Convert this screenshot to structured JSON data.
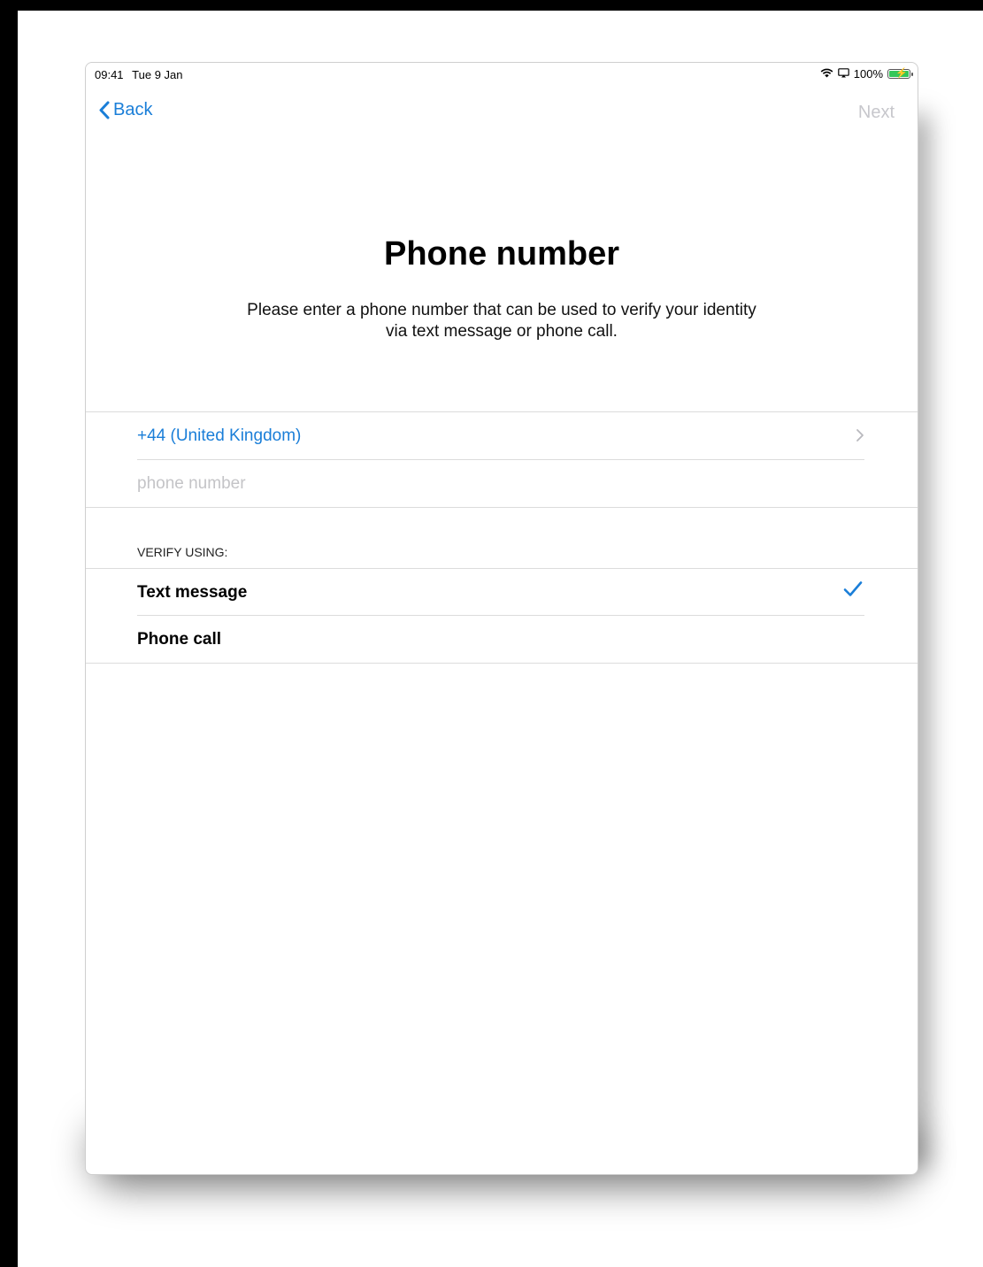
{
  "status_bar": {
    "time": "09:41",
    "date": "Tue 9 Jan",
    "battery": "100%"
  },
  "nav": {
    "back_label": "Back",
    "next_label": "Next"
  },
  "page": {
    "title": "Phone number",
    "subtitle_line1": "Please enter a phone number that can be used to verify your identity",
    "subtitle_line2": "via text message or phone call."
  },
  "phone": {
    "country": "+44 (United Kingdom)",
    "placeholder": "phone number",
    "value": ""
  },
  "verify": {
    "header": "VERIFY USING:",
    "options": [
      {
        "label": "Text message",
        "selected": true
      },
      {
        "label": "Phone call",
        "selected": false
      }
    ]
  },
  "colors": {
    "accent": "#1a7ed8",
    "disabled": "#c7c7cc",
    "battery": "#34c759"
  },
  "icons": [
    "wifi-icon",
    "screen-mirror-icon",
    "battery-icon",
    "chevron-left-icon",
    "chevron-right-icon",
    "checkmark-icon"
  ]
}
